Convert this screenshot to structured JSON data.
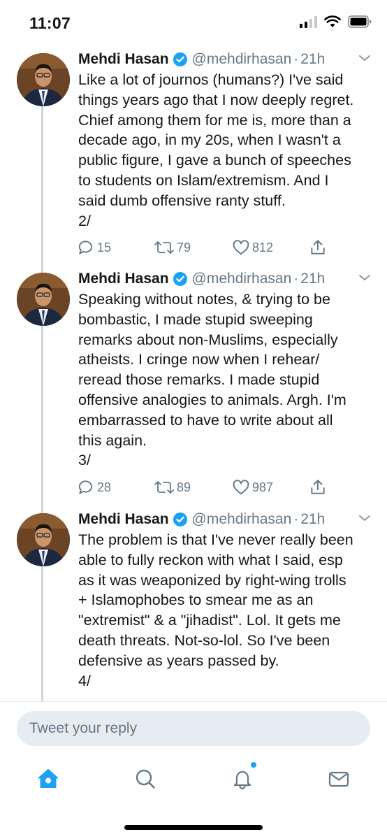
{
  "status_bar": {
    "time": "11:07"
  },
  "thread": {
    "tweets": [
      {
        "author": "Mehdi Hasan",
        "handle": "@mehdirhasan",
        "separator": "·",
        "time": "21h",
        "text": "Like a lot of journos (humans?) I've said\nthings years ago that I now deeply regret.\nChief among them for me is, more than a\ndecade ago, in my 20s, when I wasn't a\npublic figure, I gave a bunch of speeches\nto students on Islam/extremism. And I\nsaid dumb offensive ranty stuff.\n2/",
        "replies": "15",
        "retweets": "79",
        "likes": "812"
      },
      {
        "author": "Mehdi Hasan",
        "handle": "@mehdirhasan",
        "separator": "·",
        "time": "21h",
        "text": "Speaking without notes, & trying to be\nbombastic, I made stupid sweeping\nremarks about non-Muslims, especially\natheists. I cringe now when I rehear/\nreread those remarks. I made stupid\noffensive analogies to animals. Argh. I'm\nembarrassed to have to write about all\nthis again.\n3/",
        "replies": "28",
        "retweets": "89",
        "likes": "987"
      },
      {
        "author": "Mehdi Hasan",
        "handle": "@mehdirhasan",
        "separator": "·",
        "time": "21h",
        "text": "The problem is that I've never really been\nable to fully reckon with what I said, esp\nas it was weaponized by right-wing trolls\n+ Islamophobes to smear me as an\n\"extremist\" & a \"jihadist\". Lol. It gets me\ndeath threats. Not-so-lol. So I've been\ndefensive as years passed by.\n4/"
      }
    ]
  },
  "reply_bar": {
    "placeholder": "Tweet your reply"
  },
  "tab_bar": {
    "items": [
      {
        "icon": "home-icon",
        "active": true
      },
      {
        "icon": "search-icon"
      },
      {
        "icon": "notifications-icon",
        "badge_dot": true
      },
      {
        "icon": "messages-icon"
      }
    ]
  },
  "colors": {
    "accent": "#1da1f2",
    "text": "#14171a",
    "secondary_text": "#657786",
    "thread_line": "#cbd5dd",
    "reply_field": "#e6ecf0"
  }
}
